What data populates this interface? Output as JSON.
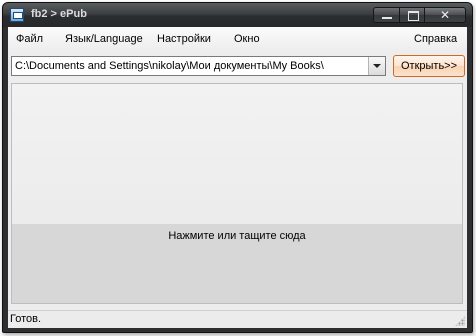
{
  "window": {
    "title": "fb2 > ePub",
    "controls": {
      "minimize": "minimize-icon",
      "maximize": "maximize-icon",
      "close": "✕"
    }
  },
  "menu": {
    "file": "Файл",
    "language": "Язык/Language",
    "settings": "Настройки",
    "window": "Окно",
    "help": "Справка"
  },
  "toolbar": {
    "path_value": "C:\\Documents and Settings\\nikolay\\Мои документы\\My Books\\",
    "open_label": "Открыть>>"
  },
  "drop_zone": {
    "label": "Нажмите или тащите сюда"
  },
  "status": {
    "text": "Готов."
  },
  "colors": {
    "accent_border": "#c96a2a",
    "titlebar": "#3c3f42"
  }
}
